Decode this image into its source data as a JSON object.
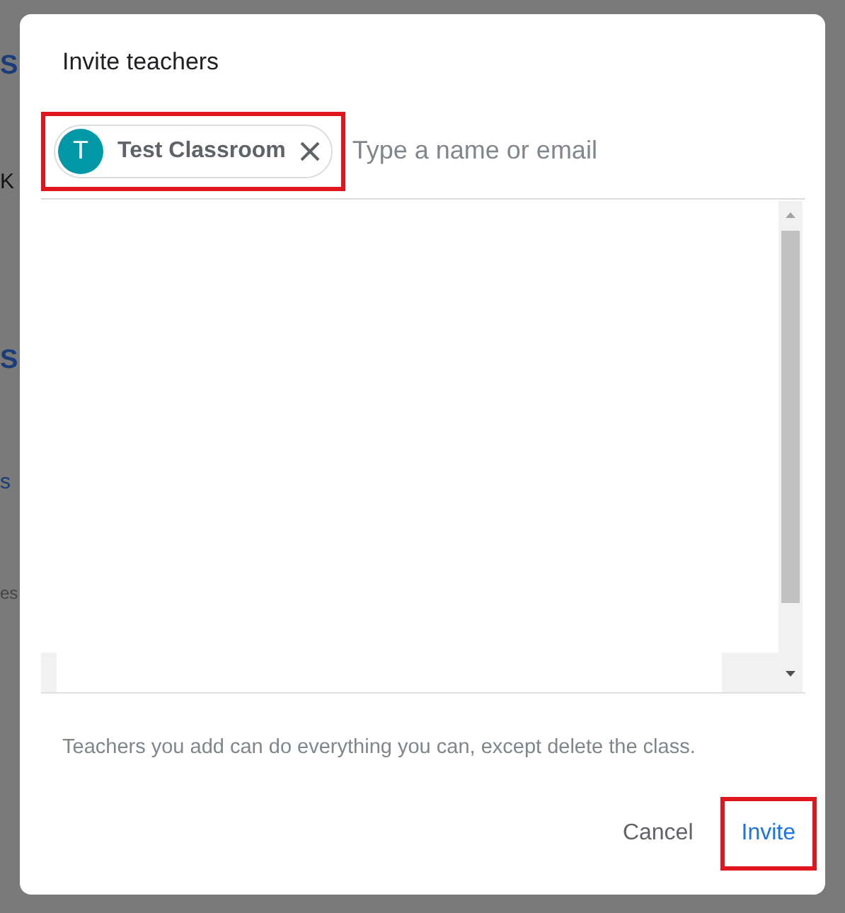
{
  "background_page": {
    "fragments": [
      {
        "kind": "heading",
        "text": "S"
      },
      {
        "kind": "text",
        "text": "K"
      },
      {
        "kind": "heading",
        "text": "S"
      },
      {
        "kind": "link",
        "text": "s"
      },
      {
        "kind": "muted",
        "text": "es"
      }
    ]
  },
  "dialog": {
    "title": "Invite teachers",
    "recipients": [
      {
        "initial": "T",
        "name": "Test Classroom",
        "color": "#0097a7",
        "highlighted": true
      }
    ],
    "input": {
      "placeholder": "Type a name or email"
    },
    "note": "Teachers you add can do everything you can, except delete the class.",
    "buttons": [
      {
        "kind": "text",
        "label": "Cancel",
        "highlighted": false
      },
      {
        "kind": "primary",
        "label": "Invite",
        "highlighted": true
      }
    ]
  }
}
